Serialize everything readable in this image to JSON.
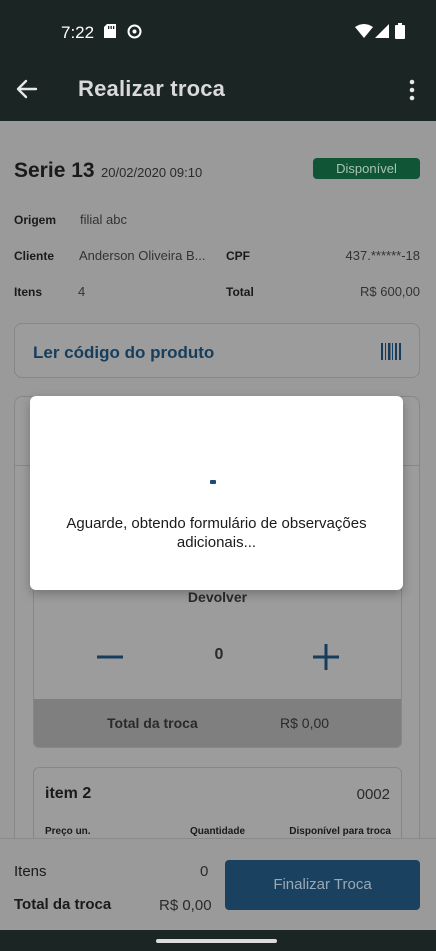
{
  "status_bar": {
    "time": "7:22",
    "icons": [
      "sd-card-icon",
      "sync-icon",
      "wifi-icon",
      "signal-icon",
      "battery-icon"
    ]
  },
  "app_bar": {
    "title": "Realizar troca",
    "back_icon": "arrow-left-icon",
    "menu_icon": "more-vertical-icon"
  },
  "header": {
    "serie": "Serie 13",
    "datetime": "20/02/2020 09:10",
    "status": "Disponível"
  },
  "details": {
    "origem_label": "Origem",
    "origem_value": "filial abc",
    "cliente_label": "Cliente",
    "cliente_value": "Anderson Oliveira B...",
    "cpf_label": "CPF",
    "cpf_value": "437.******-18",
    "itens_label": "Itens",
    "itens_value": "4",
    "total_label": "Total",
    "total_value": "R$ 600,00"
  },
  "scan": {
    "label": "Ler código do produto",
    "icon": "barcode-icon"
  },
  "devolver": {
    "label": "Devolver",
    "quantity": "0",
    "total_label": "Total da troca",
    "total_value": "R$ 0,00"
  },
  "item2": {
    "name": "item 2",
    "code": "0002",
    "col_price": "Preço un.",
    "col_qty": "Quantidade",
    "col_available": "Disponível para troca"
  },
  "bottom": {
    "itens_label": "Itens",
    "itens_value": "0",
    "total_label": "Total da troca",
    "total_value": "R$ 0,00",
    "button": "Finalizar Troca"
  },
  "dialog": {
    "message": "Aguarde, obtendo formulário de observações adicionais..."
  },
  "colors": {
    "status_bar": "#1b2523",
    "accent": "#1b4160",
    "badge": "#0f5536",
    "scrim_gray": "#9a9a9a"
  }
}
